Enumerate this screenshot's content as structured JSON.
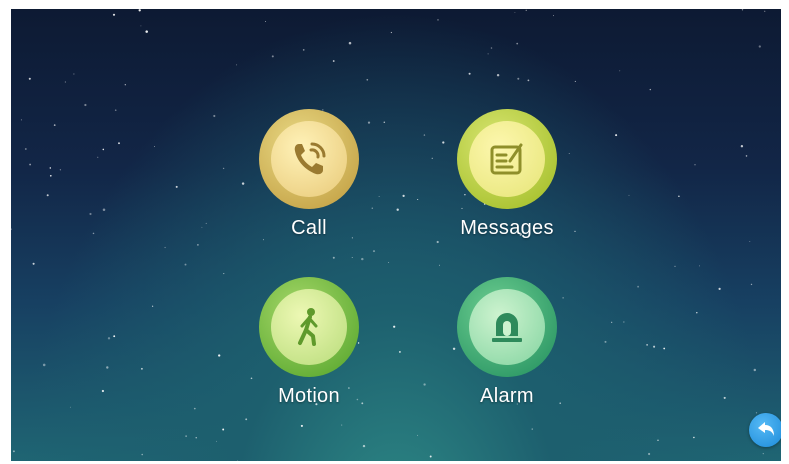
{
  "menu": {
    "items": [
      {
        "label": "Call",
        "icon": "phone-icon"
      },
      {
        "label": "Messages",
        "icon": "message-icon"
      },
      {
        "label": "Motion",
        "icon": "walking-person-icon"
      },
      {
        "label": "Alarm",
        "icon": "alarm-light-icon"
      }
    ]
  },
  "back": {
    "icon": "back-arrow-icon"
  },
  "colors": {
    "call": "#e8c978",
    "messages": "#e6e577",
    "motion": "#b8dc7a",
    "alarm": "#83d4a0",
    "back": "#1c8ad9"
  }
}
